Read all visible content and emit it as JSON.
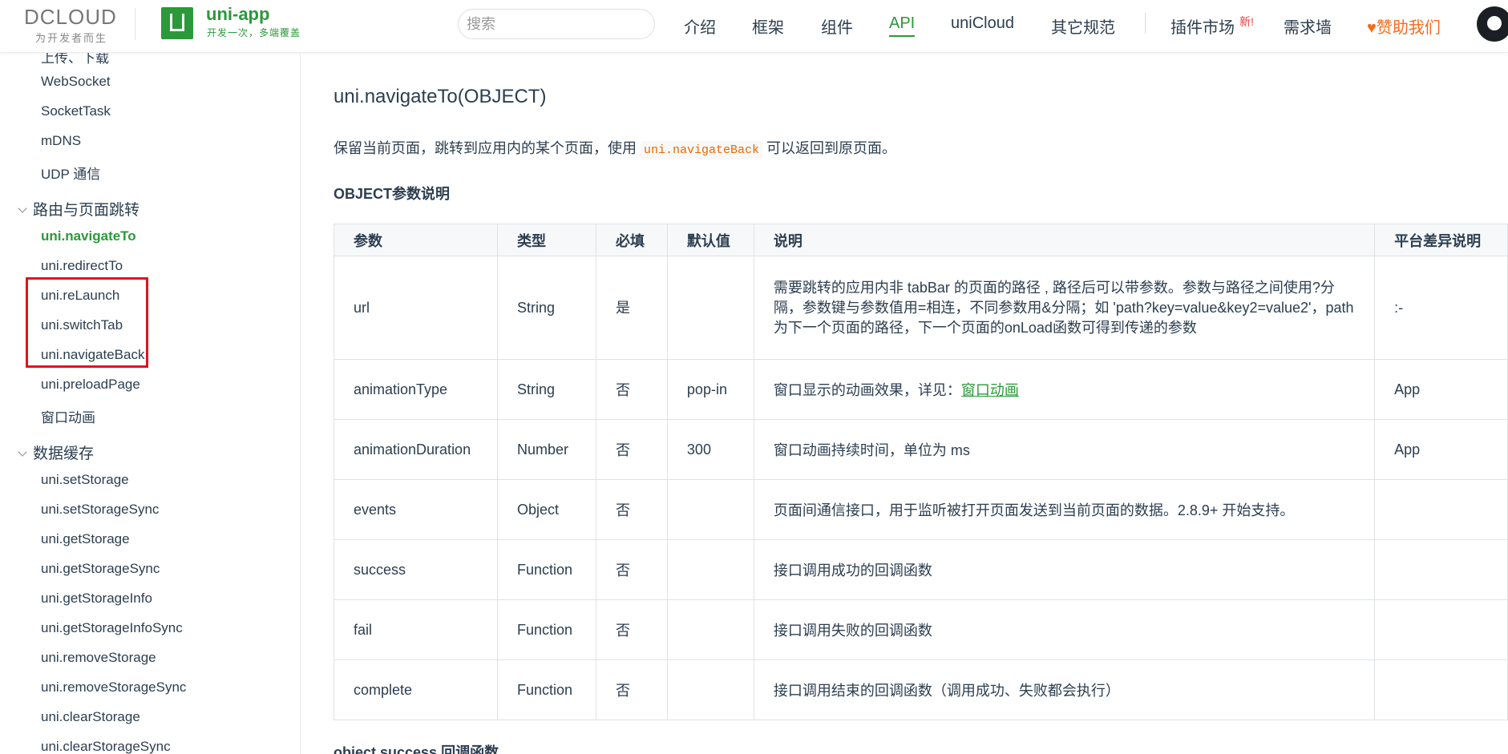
{
  "header": {
    "brand_left": "DCLOUD",
    "brand_left_slogan": "为开发者而生",
    "app_title": "uni-app",
    "app_subtitle": "开发一次，多端覆盖",
    "search_placeholder": "搜索",
    "nav": [
      {
        "label": "介绍"
      },
      {
        "label": "框架"
      },
      {
        "label": "组件"
      },
      {
        "label": "API",
        "active": true
      },
      {
        "label": "uniCloud"
      },
      {
        "label": "其它规范"
      }
    ],
    "plugins_label": "插件市场",
    "new_badge": "新!",
    "requests_label": "需求墙",
    "sponsor_label": "赞助我们",
    "colors": {
      "brand_green": "#2b9939",
      "sponsor_orange": "#f56c1b",
      "badge_red": "#e83e3e"
    }
  },
  "sidebar": {
    "top_cut_label": "上传、下载",
    "items_a": [
      "WebSocket",
      "SocketTask",
      "mDNS",
      "UDP 通信"
    ],
    "group_route": "路由与页面跳转",
    "route_items": [
      {
        "label": "uni.navigateTo",
        "active": true
      },
      {
        "label": "uni.redirectTo"
      },
      {
        "label": "uni.reLaunch"
      },
      {
        "label": "uni.switchTab"
      },
      {
        "label": "uni.navigateBack"
      },
      {
        "label": "uni.preloadPage"
      },
      {
        "label": "窗口动画"
      }
    ],
    "group_storage": "数据缓存",
    "storage_items": [
      "uni.setStorage",
      "uni.setStorageSync",
      "uni.getStorage",
      "uni.getStorageSync",
      "uni.getStorageInfo",
      "uni.getStorageInfoSync",
      "uni.removeStorage",
      "uni.removeStorageSync",
      "uni.clearStorage",
      "uni.clearStorageSync"
    ],
    "highlight_color": "#e3121f"
  },
  "main": {
    "title": "uni.navigateTo(OBJECT)",
    "intro_before": "保留当前页面，跳转到应用内的某个页面，使用 ",
    "intro_code": "uni.navigateBack",
    "intro_after": " 可以返回到原页面。",
    "section_heading": "OBJECT参数说明",
    "table": {
      "headers": [
        "参数",
        "类型",
        "必填",
        "默认值",
        "说明",
        "平台差异说明"
      ],
      "rows": [
        {
          "name": "url",
          "type": "String",
          "required": "是",
          "default": "",
          "desc": "需要跳转的应用内非 tabBar 的页面的路径 , 路径后可以带参数。参数与路径之间使用?分隔，参数键与参数值用=相连，不同参数用&分隔；如 'path?key=value&key2=value2'，path为下一个页面的路径，下一个页面的onLoad函数可得到传递的参数",
          "platform": ":-"
        },
        {
          "name": "animationType",
          "type": "String",
          "required": "否",
          "default": "pop-in",
          "desc": "窗口显示的动画效果，详见：",
          "link": "窗口动画",
          "platform": "App"
        },
        {
          "name": "animationDuration",
          "type": "Number",
          "required": "否",
          "default": "300",
          "desc": "窗口动画持续时间，单位为 ms",
          "platform": "App"
        },
        {
          "name": "events",
          "type": "Object",
          "required": "否",
          "default": "",
          "desc": "页面间通信接口，用于监听被打开页面发送到当前页面的数据。2.8.9+ 开始支持。",
          "platform": ""
        },
        {
          "name": "success",
          "type": "Function",
          "required": "否",
          "default": "",
          "desc": "接口调用成功的回调函数",
          "platform": ""
        },
        {
          "name": "fail",
          "type": "Function",
          "required": "否",
          "default": "",
          "desc": "接口调用失败的回调函数",
          "platform": ""
        },
        {
          "name": "complete",
          "type": "Function",
          "required": "否",
          "default": "",
          "desc": "接口调用结束的回调函数（调用成功、失败都会执行）",
          "platform": ""
        }
      ]
    },
    "next_heading": "object.success 回调函数"
  }
}
